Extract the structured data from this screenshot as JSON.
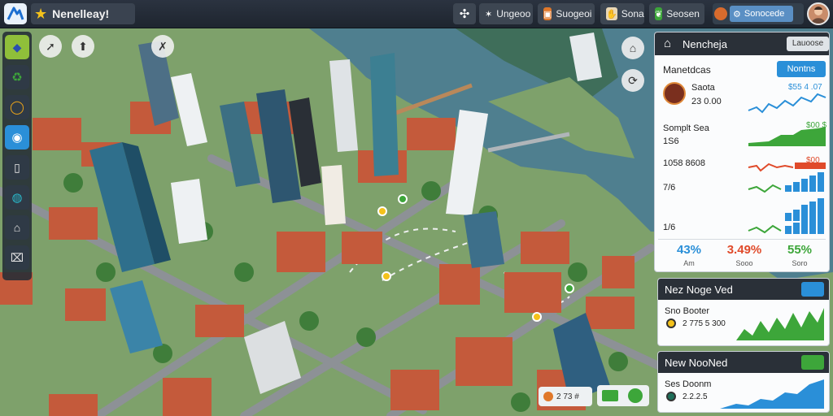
{
  "topbar": {
    "city_name": "Nenelleay!",
    "btn1_label": "Ungeoo",
    "btn2_label": "Suogeoi",
    "btn3_label": "Sona",
    "btn4_label": "Seosen",
    "account_label": "Sonocede"
  },
  "panel": {
    "title": "Nencheja",
    "badge": "Lauoose",
    "subheader": "Manetdcas",
    "subheader_button": "Nontns",
    "rows": [
      {
        "label": "Saota",
        "value": "$55 4 .07",
        "sub": "23 0.00"
      },
      {
        "label": "Somplt Sea",
        "value": "$00 $"
      },
      {
        "label": "1S6"
      },
      {
        "label": "1058 8608",
        "value": "$00"
      },
      {
        "label": "7/6"
      },
      {
        "label": "1/6"
      }
    ],
    "stats": [
      {
        "value": "43%",
        "sub": "Am",
        "color": "#2a8fd8"
      },
      {
        "value": "3.49%",
        "sub": "Sooo",
        "color": "#e04a2a"
      },
      {
        "value": "55%",
        "sub": "Soro",
        "color": "#3da63a"
      }
    ]
  },
  "card1": {
    "title": "Nez Noge Ved",
    "pill": "",
    "label": "Sno Booter",
    "value": "2 775 5 300"
  },
  "card2": {
    "title": "New NooNed",
    "pill": "",
    "label": "Ses Doonm",
    "value": "2.2.2.5"
  },
  "bottom": {
    "chip_label": "2 73 #",
    "colors": {
      "accent": "#2a8fd8",
      "green": "#3da63a",
      "red": "#e04a2a"
    }
  }
}
